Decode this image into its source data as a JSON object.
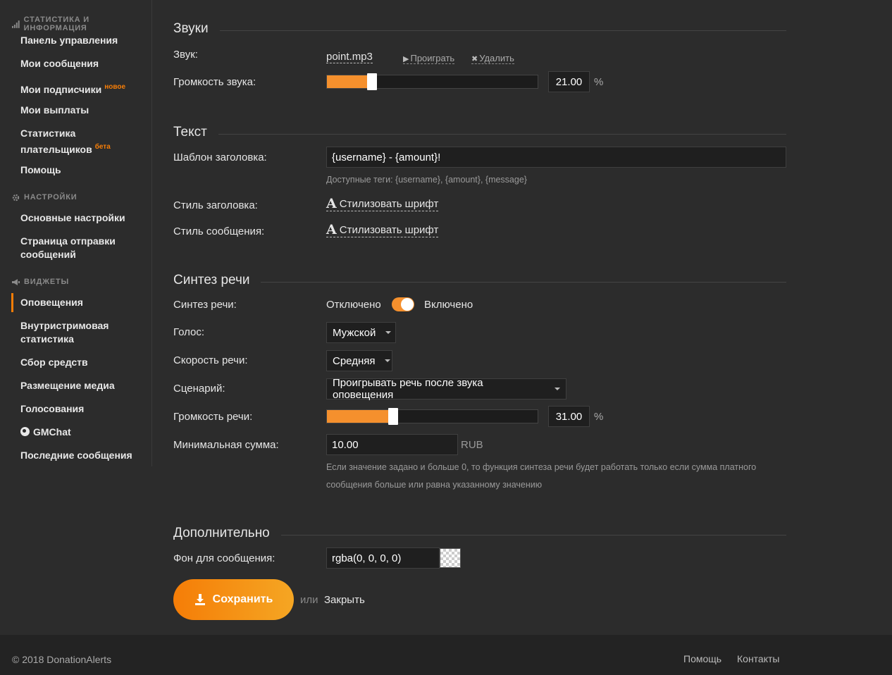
{
  "sidebar": {
    "groups": {
      "stats": "СТАТИСТИКА И ИНФОРМАЦИЯ",
      "settings": "НАСТРОЙКИ",
      "widgets": "ВИДЖЕТЫ"
    },
    "items": {
      "dashboard": "Панель управления",
      "messages": "Мои сообщения",
      "subscribers": "Мои подписчики",
      "subscribers_badge": "новое",
      "payouts": "Мои выплаты",
      "payer_stats": "Статистика плательщиков",
      "payer_stats_badge": "бета",
      "help": "Помощь",
      "basic_settings": "Основные настройки",
      "send_page": "Страница отправки сообщений",
      "alerts": "Оповещения",
      "stream_stats": "Внутристримовая статистика",
      "fundraising": "Сбор средств",
      "media": "Размещение медиа",
      "polls": "Голосования",
      "gmchat": "GMChat",
      "last_messages": "Последние сообщения"
    }
  },
  "sounds": {
    "title": "Звуки",
    "sound_label": "Звук:",
    "file": "point.mp3",
    "play": "Проиграть",
    "delete": "Удалить",
    "volume_label": "Громкость звука:",
    "volume_value": "21.00",
    "volume_fraction": 0.21,
    "percent": "%"
  },
  "text": {
    "title": "Текст",
    "template_label": "Шаблон заголовка:",
    "template_value": "{username} - {amount}!",
    "tags_hint": "Доступные теги: {username}, {amount}, {message}",
    "header_style_label": "Стиль заголовка:",
    "message_style_label": "Стиль сообщения:",
    "style_link": "Стилизовать шрифт"
  },
  "tts": {
    "title": "Синтез речи",
    "enabled_label": "Синтез речи:",
    "off": "Отключено",
    "on": "Включено",
    "voice_label": "Голос:",
    "voice_value": "Мужской",
    "speed_label": "Скорость речи:",
    "speed_value": "Средняя",
    "scenario_label": "Сценарий:",
    "scenario_value": "Проигрывать речь после звука оповещения",
    "volume_label": "Громкость речи:",
    "volume_value": "31.00",
    "volume_fraction": 0.31,
    "percent": "%",
    "min_amount_label": "Минимальная сумма:",
    "min_amount_value": "10.00",
    "currency": "RUB",
    "hint_line1": "Если значение задано и больше 0, то функция синтеза речи будет работать только если сумма платного",
    "hint_line2": "сообщения больше или равна указанному значению"
  },
  "extra": {
    "title": "Дополнительно",
    "bg_label": "Фон для сообщения:",
    "bg_value": "rgba(0, 0, 0, 0)"
  },
  "actions": {
    "save": "Сохранить",
    "or": "или",
    "close": "Закрыть"
  },
  "footer": {
    "copyright": "© 2018 DonationAlerts",
    "help": "Помощь",
    "contacts": "Контакты"
  },
  "colors": {
    "accent": "#f57d07",
    "slider_fill": "#f5902d",
    "background": "#2c2c2c"
  }
}
